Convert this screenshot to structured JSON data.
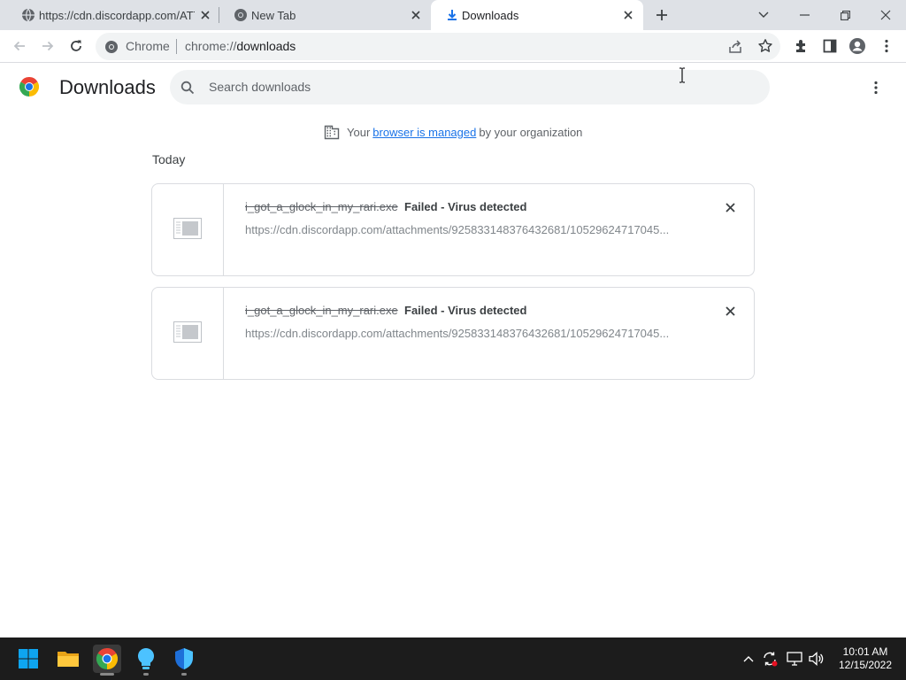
{
  "browser": {
    "tabs": [
      {
        "title": "https://cdn.discordapp.com/ATTA",
        "icon": "globe-icon",
        "active": false
      },
      {
        "title": "New Tab",
        "icon": "chrome-icon",
        "active": false
      },
      {
        "title": "Downloads",
        "icon": "download-icon",
        "active": true
      }
    ],
    "omnibox": {
      "chip": "Chrome",
      "url_scheme": "chrome://",
      "url_path": "downloads"
    }
  },
  "page": {
    "title": "Downloads",
    "search_placeholder": "Search downloads",
    "managed": {
      "prefix": "Your",
      "link": "browser is managed",
      "suffix": "by your organization"
    },
    "section": "Today",
    "downloads": [
      {
        "filename": "i_got_a_glock_in_my_rari.exe",
        "status": "Failed - Virus detected",
        "url": "https://cdn.discordapp.com/attachments/925833148376432681/10529624717045..."
      },
      {
        "filename": "i_got_a_glock_in_my_rari.exe",
        "status": "Failed - Virus detected",
        "url": "https://cdn.discordapp.com/attachments/925833148376432681/10529624717045..."
      }
    ]
  },
  "taskbar": {
    "apps": [
      "windows-start-icon",
      "file-explorer-icon",
      "chrome-icon",
      "tips-icon",
      "defender-icon"
    ],
    "clock": {
      "time": "10:01 AM",
      "date": "12/15/2022"
    }
  },
  "colors": {
    "accent": "#1a73e8",
    "tabstrip": "#dee1e6",
    "omnibox": "#f1f3f4",
    "taskbar": "#1c1c1c"
  }
}
